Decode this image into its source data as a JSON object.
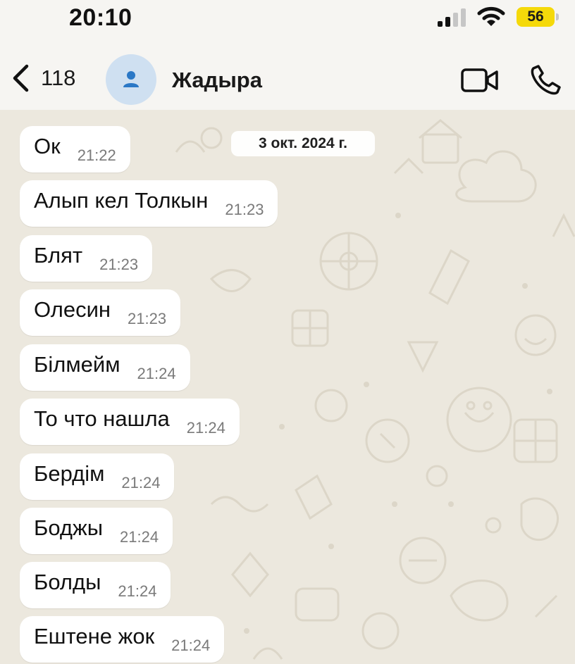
{
  "status_bar": {
    "time": "20:10",
    "battery": "56"
  },
  "nav": {
    "back_count": "118",
    "contact_name": "Жадыра"
  },
  "chat": {
    "date_label": "3 окт. 2024 г.",
    "messages": [
      {
        "text": "Ок",
        "time": "21:22"
      },
      {
        "text": "Алып кел Толкын",
        "time": "21:23"
      },
      {
        "text": "Блят",
        "time": "21:23"
      },
      {
        "text": "Олесин",
        "time": "21:23"
      },
      {
        "text": "Білмейм",
        "time": "21:24"
      },
      {
        "text": "То что нашла",
        "time": "21:24"
      },
      {
        "text": "Бердім",
        "time": "21:24"
      },
      {
        "text": "Боджы",
        "time": "21:24"
      },
      {
        "text": "Болды",
        "time": "21:24"
      },
      {
        "text": "Ештене жок",
        "time": "21:24"
      }
    ]
  },
  "icons": {
    "back": "chevron-left-icon",
    "avatar": "person-icon",
    "video": "video-camera-icon",
    "phone": "phone-icon",
    "signal": "cellular-signal-icon",
    "wifi": "wifi-icon",
    "battery": "battery-icon"
  },
  "colors": {
    "background": "#ece8de",
    "bubble": "#ffffff",
    "avatar_bg": "#cfe0f1",
    "avatar_icon": "#2b78c6",
    "battery": "#f5d90a",
    "timestamp": "#7a7a7a"
  }
}
